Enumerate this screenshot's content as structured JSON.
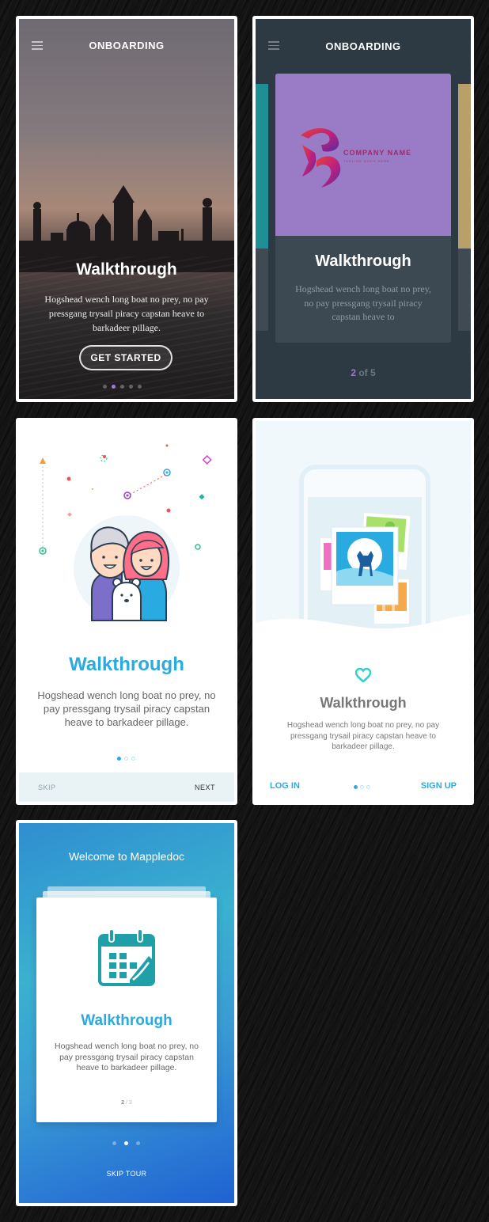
{
  "screens": {
    "s1": {
      "header_title": "ONBOARDING",
      "title": "Walkthrough",
      "body": "Hogshead wench long boat no prey, no pay pressgang trysail piracy capstan heave to barkadeer pillage.",
      "button_label": "GET STARTED",
      "pager": {
        "count": 5,
        "active_index": 1
      },
      "colors": {
        "active_dot": "#a07fd0"
      }
    },
    "s2": {
      "header_title": "ONBOARDING",
      "company_name": "COMPANY NAME",
      "company_tagline": "TAGLINE GOES HERE",
      "title": "Walkthrough",
      "body": "Hogshead wench long boat no prey, no pay pressgang trysail piracy capstan heave to",
      "pager_current": "2",
      "pager_rest": " of 5",
      "colors": {
        "card_image": "#9a7bc6",
        "background": "#2e3a43",
        "left_peek": "#1f8f96",
        "right_peek": "#b99f6a"
      }
    },
    "s3": {
      "title": "Walkthrough",
      "body": "Hogshead wench long boat no prey, no pay pressgang trysail piracy capstan heave to barkadeer pillage.",
      "pager": {
        "count": 3,
        "active_index": 0
      },
      "skip_label": "SKIP",
      "next_label": "NEXT",
      "colors": {
        "accent": "#29abe2"
      }
    },
    "s4": {
      "title": "Walkthrough",
      "body": "Hogshead wench long boat no prey, no pay pressgang trysail piracy capstan heave to barkadeer pillage.",
      "login_label": "LOG IN",
      "signup_label": "SIGN UP",
      "pager": {
        "count": 3,
        "active_index": 0
      },
      "icons": [
        "heart-icon",
        "deer-photo-icon"
      ],
      "colors": {
        "accent": "#29abe2"
      }
    },
    "s5": {
      "header": "Welcome to Mappledoc",
      "title": "Walkthrough",
      "body": "Hogshead wench long boat no prey, no pay pressgang trysail piracy capstan heave to barkadeer pillage.",
      "pager_current": "2",
      "pager_rest": " / 3",
      "dots": {
        "count": 3,
        "active_index": 1
      },
      "skip_label": "SKIP TOUR",
      "icons": [
        "calendar-icon"
      ],
      "colors": {
        "accent": "#29abe2",
        "gradient_start": "#3ab1cf",
        "gradient_end": "#1f62d3"
      }
    }
  }
}
